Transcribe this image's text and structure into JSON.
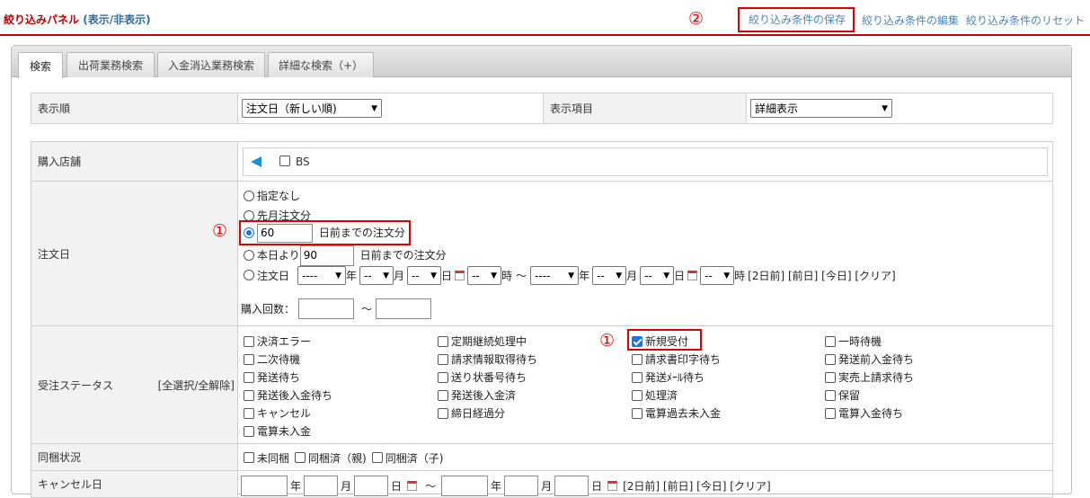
{
  "header": {
    "panel_title": "絞り込みパネル",
    "toggle": "(表示/非表示)",
    "links": {
      "save": "絞り込み条件の保存",
      "edit": "絞り込み条件の編集",
      "reset": "絞り込み条件のリセット"
    },
    "marker_save": "②"
  },
  "tabs": [
    {
      "label": "検索",
      "active": true
    },
    {
      "label": "出荷業務検索",
      "active": false
    },
    {
      "label": "入金消込業務検索",
      "active": false
    },
    {
      "label": "詳細な検索（+）",
      "active": false
    }
  ],
  "display": {
    "order_label": "表示順",
    "order_value": "注文日（新しい順)",
    "items_label": "表示項目",
    "items_value": "詳細表示"
  },
  "store": {
    "label": "購入店舗",
    "options": [
      {
        "label": "BS",
        "checked": false
      }
    ]
  },
  "order_date": {
    "label": "注文日",
    "marker": "①",
    "opt_none": "指定なし",
    "opt_last_month": "先月注文分",
    "days_before_value": "60",
    "days_before_suffix": "日前までの注文分",
    "from_today_prefix": "本日より",
    "from_today_value": "90",
    "from_today_suffix": "日前までの注文分",
    "range_prefix": "注文日",
    "dash4": "----",
    "dash2": "--",
    "unit_year": "年",
    "unit_month": "月",
    "unit_day": "日",
    "unit_hour": "時",
    "tilde": "〜",
    "quick": "[2日前] [前日] [今日] [クリア]",
    "purchase_count_label": "購入回数：",
    "purchase_tilde": "〜",
    "selected_option": "days_before"
  },
  "status": {
    "label": "受注ステータス",
    "select_all": "[全選択/全解除]",
    "marker": "①",
    "items": [
      {
        "label": "決済エラー",
        "checked": false
      },
      {
        "label": "定期継続処理中",
        "checked": false
      },
      {
        "label": "新規受付",
        "checked": true
      },
      {
        "label": "一時待機",
        "checked": false
      },
      {
        "label": "二次待機",
        "checked": false
      },
      {
        "label": "請求情報取得待ち",
        "checked": false
      },
      {
        "label": "請求書印字待ち",
        "checked": false
      },
      {
        "label": "発送前入金待ち",
        "checked": false
      },
      {
        "label": "発送待ち",
        "checked": false
      },
      {
        "label": "送り状番号待ち",
        "checked": false
      },
      {
        "label": "発送ﾒｰﾙ待ち",
        "checked": false
      },
      {
        "label": "実売上請求待ち",
        "checked": false
      },
      {
        "label": "発送後入金待ち",
        "checked": false
      },
      {
        "label": "発送後入金済",
        "checked": false
      },
      {
        "label": "処理済",
        "checked": false
      },
      {
        "label": "保留",
        "checked": false
      },
      {
        "label": "キャンセル",
        "checked": false
      },
      {
        "label": "締日経過分",
        "checked": false
      },
      {
        "label": "電算過去未入金",
        "checked": false
      },
      {
        "label": "電算入金待ち",
        "checked": false
      },
      {
        "label": "電算未入金",
        "checked": false
      }
    ]
  },
  "bundle": {
    "label": "同梱状況",
    "options": [
      {
        "label": "未同梱",
        "checked": false
      },
      {
        "label": "同梱済（親)",
        "checked": false
      },
      {
        "label": "同梱済（子)",
        "checked": false
      }
    ]
  },
  "cancel_date": {
    "label": "キャンセル日",
    "quick": "[2日前] [前日] [今日] [クリア]"
  }
}
